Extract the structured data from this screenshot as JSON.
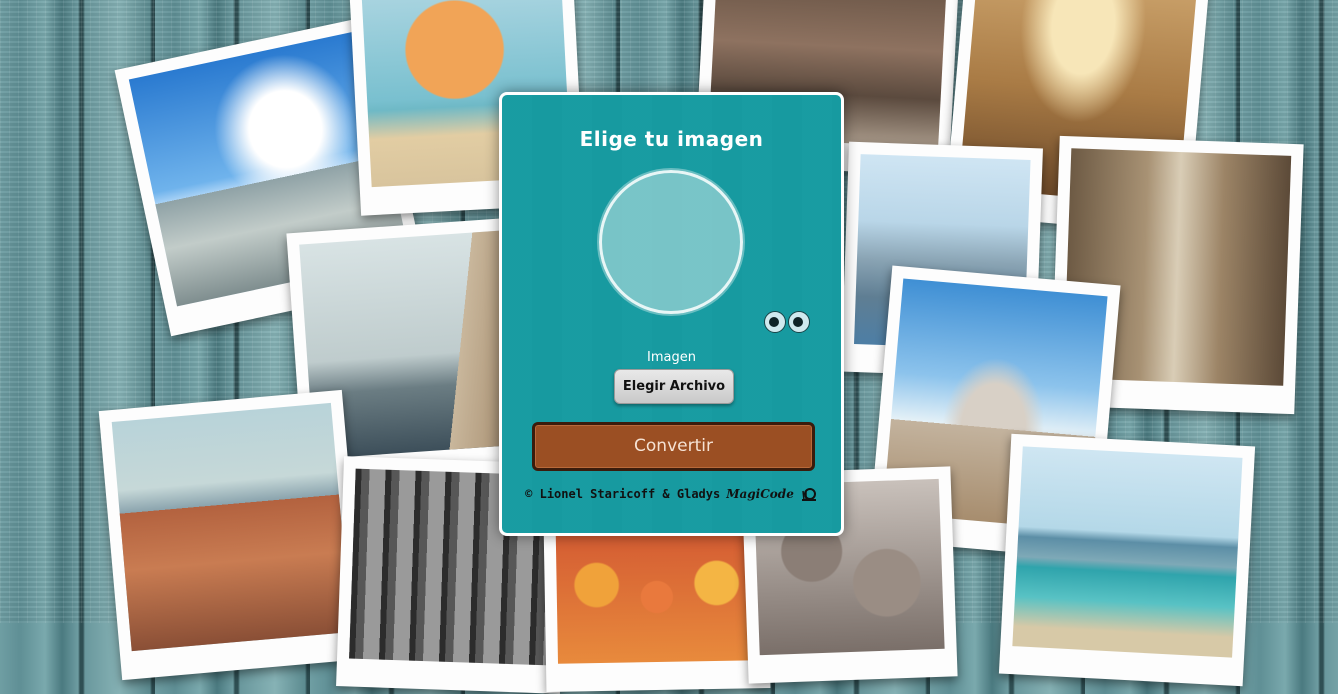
{
  "card": {
    "title": "Elige tu imagen",
    "field_label": "Imagen",
    "file_button_label": "Elegir Archivo",
    "convert_button_label": "Convertir",
    "credits": "© Lionel Staricoff & Gladys",
    "brand": "MagiCode",
    "accent_color": "#1a9aa0",
    "button_color": "#9b4f23"
  },
  "icons": [
    "eyes-icon",
    "snail-logo-icon"
  ]
}
